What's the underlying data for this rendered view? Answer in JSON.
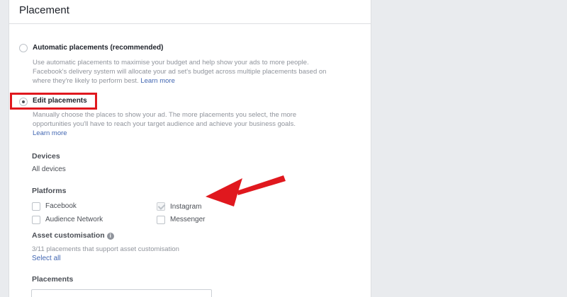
{
  "header": {
    "title": "Placement"
  },
  "automatic": {
    "title": "Automatic placements (recommended)",
    "desc1": "Use automatic placements to maximise your budget and help show your ads to more people.",
    "desc2": "Facebook's delivery system will allocate your ad set's budget across multiple placements based on",
    "desc3": "where they're likely to perform best.",
    "learn_more": "Learn more"
  },
  "edit": {
    "title": "Edit placements",
    "desc1": "Manually choose the places to show your ad. The more placements you select, the more",
    "desc2": "opportunities you'll have to reach your target audience and achieve your business goals.",
    "learn_more": "Learn more"
  },
  "devices": {
    "label": "Devices",
    "value": "All devices"
  },
  "platforms": {
    "label": "Platforms",
    "items": [
      {
        "label": "Facebook",
        "checked": false
      },
      {
        "label": "Instagram",
        "checked": true,
        "disabled": true
      },
      {
        "label": "Audience Network",
        "checked": false
      },
      {
        "label": "Messenger",
        "checked": false
      }
    ]
  },
  "asset": {
    "label": "Asset customisation",
    "info_icon": "i",
    "desc": "3/11 placements that support asset customisation",
    "select_all": "Select all"
  },
  "placements": {
    "label": "Placements"
  },
  "colors": {
    "annotation_red": "#e0181e",
    "link_blue": "#4267b2",
    "page_bg": "#e9ebee"
  }
}
